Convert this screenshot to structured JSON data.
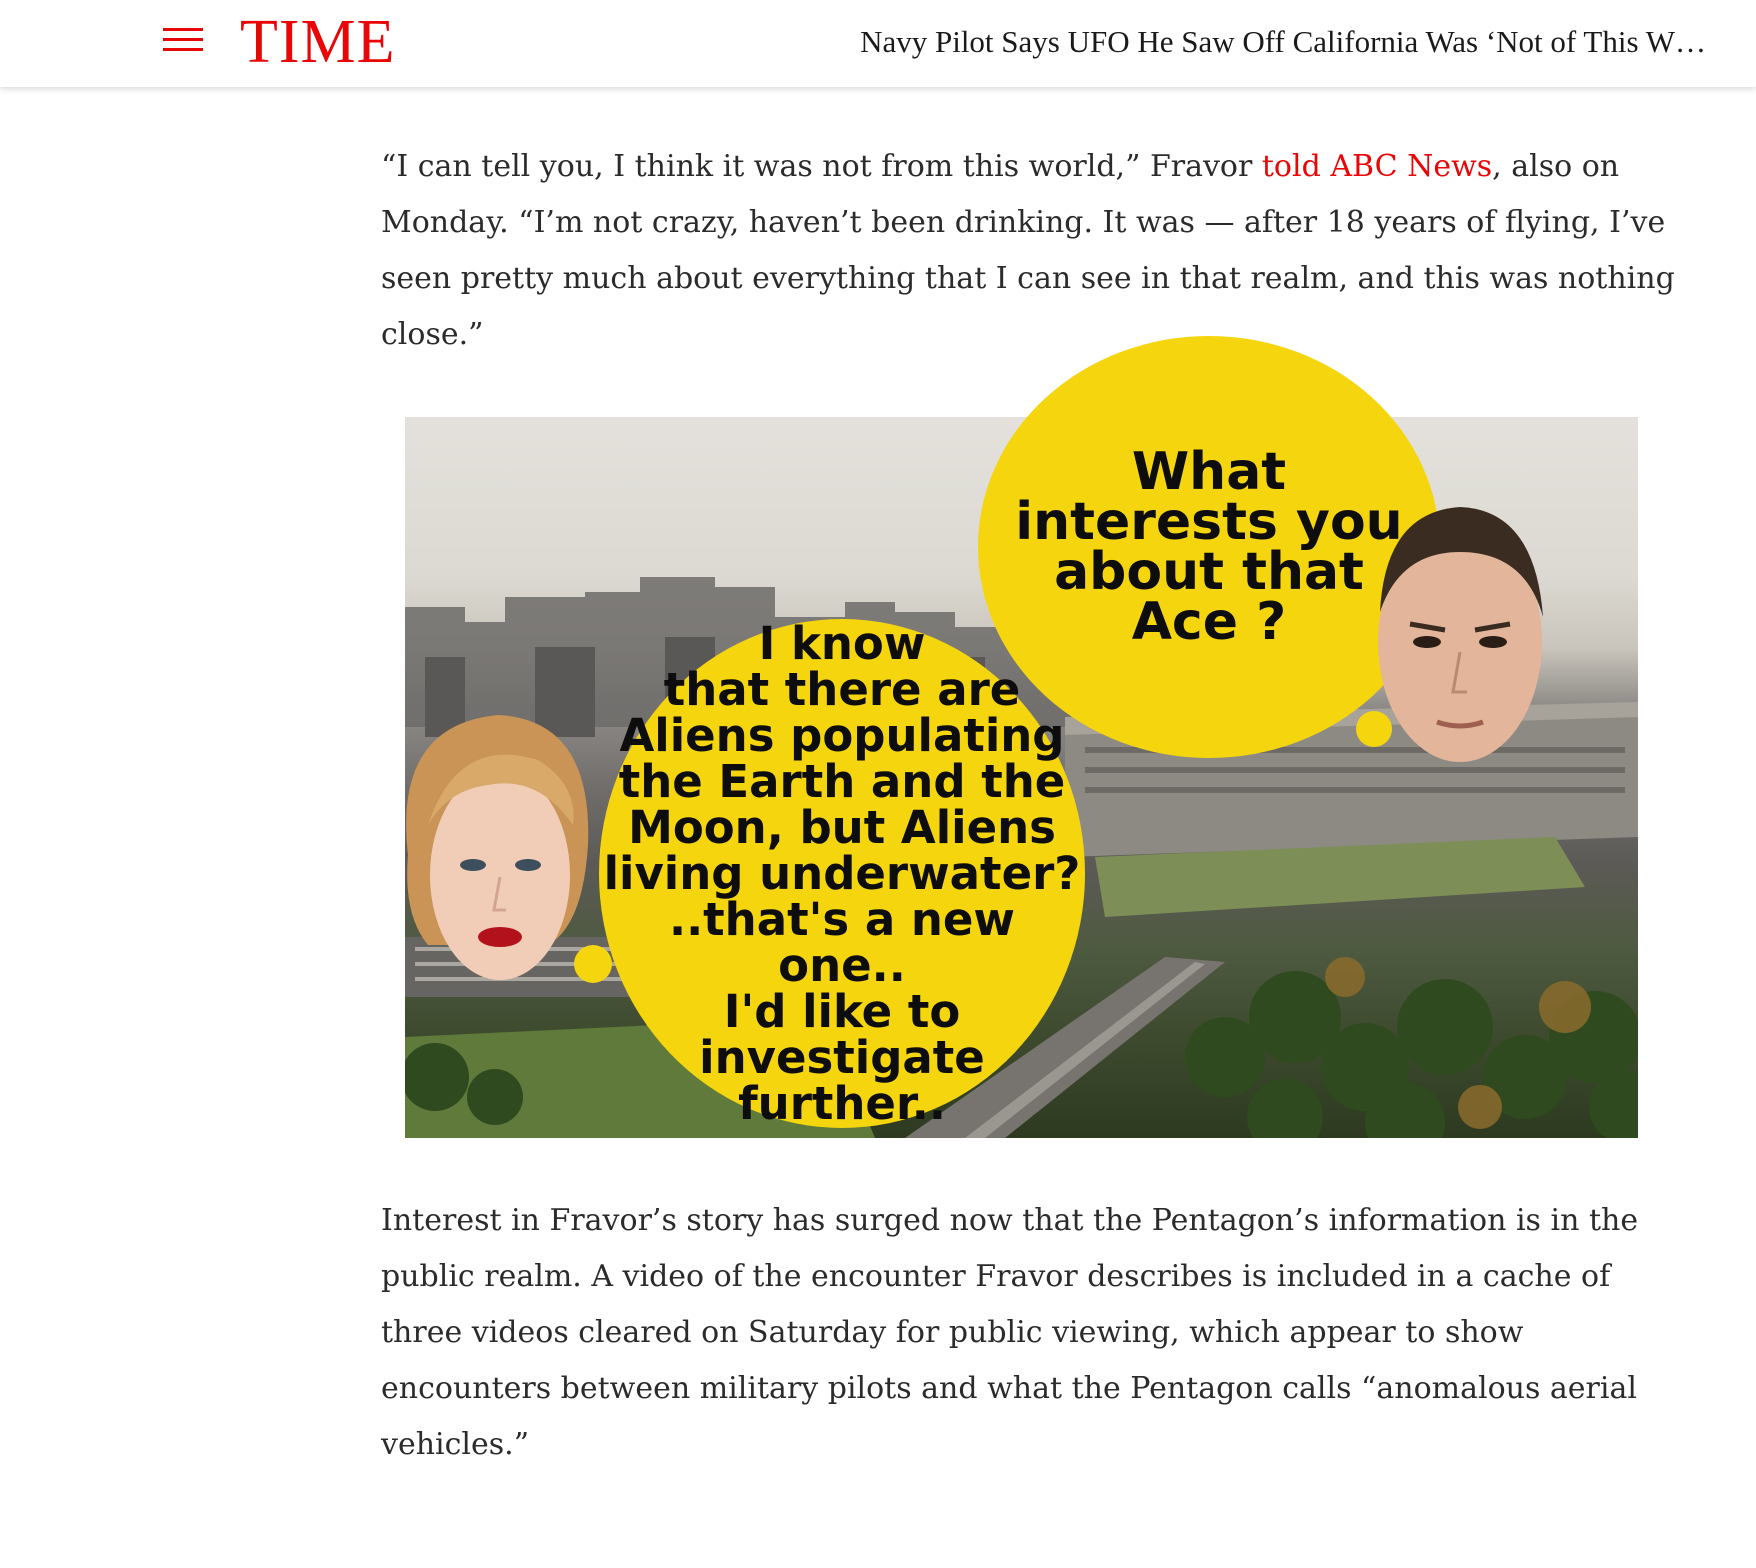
{
  "header": {
    "brand": "TIME",
    "headline": "Navy Pilot Says UFO He Saw Off California Was ‘Not of This W…",
    "brand_color": "#e90606"
  },
  "article": {
    "para1": {
      "before_link": "“I can tell you, I think it was not from this world,” Fravor ",
      "link": "told ABC News",
      "after_link": ", also on Monday. “I’m not crazy, haven’t been drinking. It was — after 18 years of flying, I’ve seen pretty much about everything that I can see in that realm, and this was nothing close.”"
    },
    "para2": "Interest in Fravor’s story has surged now that the Pentagon’s information is in the public realm. A video of the encounter Fravor describes is included in a cache of three videos cleared on Saturday for public viewing, which appear to show encounters between military pilots and what the Pentagon calls “anomalous aerial vehicles.”"
  },
  "image": {
    "bubble_right": "What\ninterests you\nabout that\nAce ?",
    "bubble_left": "I know\nthat there are\nAliens populating\nthe Earth and the\nMoon, but Aliens\nliving underwater?\n..that's a new one..\nI'd like to\ninvestigate\nfurther..",
    "bubble_color": "#f5d50e"
  }
}
